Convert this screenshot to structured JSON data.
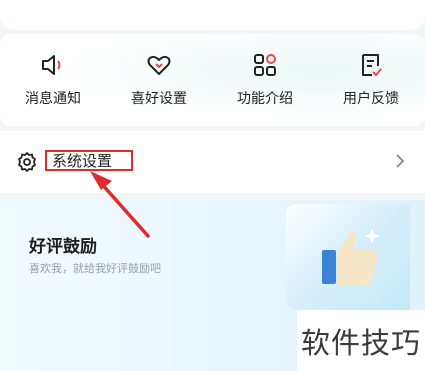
{
  "features": [
    {
      "label": "消息通知",
      "icon": "speaker-icon"
    },
    {
      "label": "喜好设置",
      "icon": "heart-icon"
    },
    {
      "label": "功能介绍",
      "icon": "grid-icon"
    },
    {
      "label": "用户反馈",
      "icon": "feedback-icon"
    }
  ],
  "settings": {
    "label": "系统设置",
    "icon": "gear-icon"
  },
  "review": {
    "title": "好评鼓励",
    "subtitle": "喜欢我，就给我好评鼓励吧"
  },
  "watermark": "软件技巧",
  "colors": {
    "highlight": "#e12a2a",
    "accent_blue": "#3b82d6"
  }
}
